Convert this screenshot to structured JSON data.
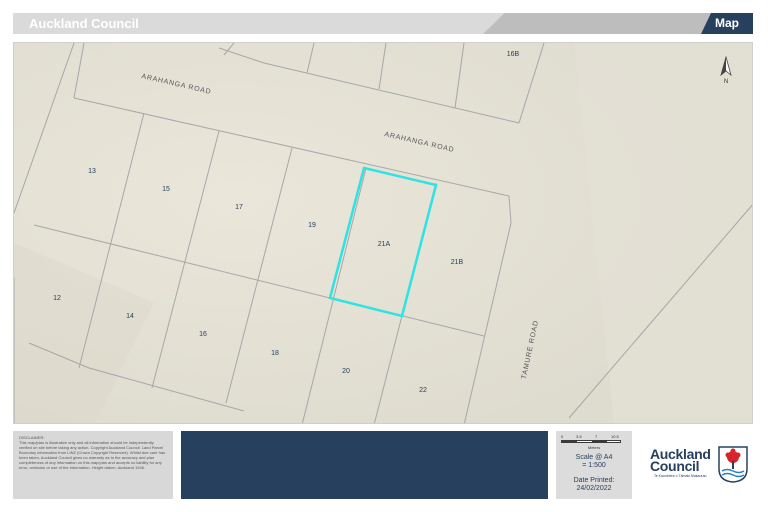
{
  "header": {
    "title": "Auckland Council",
    "tab_label": "Map"
  },
  "map": {
    "roads": {
      "arahanga_top": "ARAHANGA ROAD",
      "arahanga_mid": "ARAHANGA ROAD",
      "tamure": "TAMURE ROAD"
    },
    "parcels": [
      "16B",
      "13",
      "15",
      "17",
      "19",
      "21A",
      "21B",
      "12",
      "14",
      "16",
      "18",
      "20",
      "22"
    ],
    "highlight_parcel": "21A",
    "highlight_color": "#2de3e3",
    "north_label": "N"
  },
  "footer": {
    "disclaimer_title": "DISCLAIMER:",
    "disclaimer_text": "This map/plan is illustrative only and all information should be independently verified on site before taking any action. Copyright Auckland Council. Land Parcel Boundary information from LINZ (Crown Copyright Reserved). Whilst due care has been taken, Auckland Council gives no warranty as to the accuracy and plan completeness of any information on this map/plan and accepts no liability for any error, omission or use of the information. Height datum: Auckland 1946.",
    "scale_ticks": [
      "0",
      "3.5",
      "7",
      "10.5"
    ],
    "scale_unit": "Meters",
    "scale_label": "Scale @ A4",
    "scale_value": "= 1:500",
    "date_label": "Date Printed:",
    "date_value": "24/02/2022",
    "logo_line1": "Auckland",
    "logo_line2": "Council",
    "logo_sub": "Te Kaunihera o Tāmaki Makaurau"
  },
  "colors": {
    "navy": "#27405e",
    "header_grey": "#dadada",
    "map_bg": "#e7e3d6",
    "parcel_line": "#a7a7a7",
    "highlight": "#2de3e3"
  }
}
